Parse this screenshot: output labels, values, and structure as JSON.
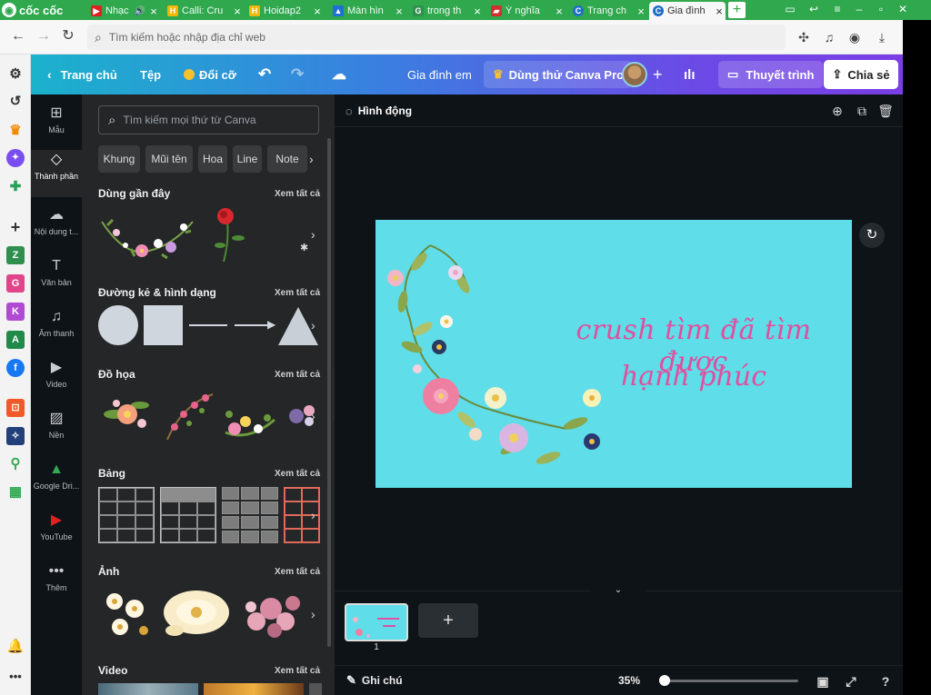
{
  "browser": {
    "brand": "cốc cốc",
    "tabs": [
      {
        "label": "Nhạc",
        "color": "#e02020",
        "glyph": "▶"
      },
      {
        "label": "Calli: Cru",
        "color": "#f2b705",
        "glyph": "H"
      },
      {
        "label": "Hoidap2",
        "color": "#f2b705",
        "glyph": "H"
      },
      {
        "label": "Màn hìn",
        "color": "#1e6fd9",
        "glyph": "▲"
      },
      {
        "label": "trong th",
        "color": "#2f8f4e",
        "glyph": "G"
      },
      {
        "label": "Ý nghĩa",
        "color": "#d32f2f",
        "glyph": "▰"
      },
      {
        "label": "Trang ch",
        "color": "#1f6fc7",
        "glyph": "C"
      },
      {
        "label": "Gia đình",
        "color": "#1f6fc7",
        "glyph": "C"
      }
    ],
    "new_tab": "+",
    "address_placeholder": "Tìm kiếm hoặc nhập địa chỉ web"
  },
  "canva": {
    "top": {
      "home": "Trang chủ",
      "file": "Tệp",
      "resize": "Đổi cỡ",
      "title": "Gia đình em",
      "pro": "Dùng thử Canva Pro",
      "present": "Thuyết trình",
      "share": "Chia sẻ"
    },
    "rail": [
      {
        "label": "Mẫu",
        "icon": "⊞"
      },
      {
        "label": "Thành phần",
        "icon": "◇"
      },
      {
        "label": "Nội dung t...",
        "icon": "☁"
      },
      {
        "label": "Văn bản",
        "icon": "T"
      },
      {
        "label": "Âm thanh",
        "icon": "♫"
      },
      {
        "label": "Video",
        "icon": "▶"
      },
      {
        "label": "Nền",
        "icon": "▨"
      },
      {
        "label": "Google Dri...",
        "icon": "▲"
      },
      {
        "label": "YouTube",
        "icon": "▶"
      },
      {
        "label": "Thêm",
        "icon": "•••"
      }
    ],
    "panel": {
      "search_placeholder": "Tìm kiếm mọi thứ từ Canva",
      "chips": [
        "Khung",
        "Mũi tên",
        "Hoa",
        "Line",
        "Note"
      ],
      "see_all": "Xem tất cả",
      "sections": {
        "recent": "Dùng gần đây",
        "lines": "Đường kẻ & hình dạng",
        "graphics": "Đồ họa",
        "tables": "Bảng",
        "photos": "Ảnh",
        "video": "Video"
      }
    },
    "editor": {
      "animate": "Hình động",
      "slide_line1": "crush tìm đã tìm được",
      "slide_line2": "hạnh phúc",
      "slide_bg": "#5fdde8",
      "text_color": "#e04fa0",
      "page_number": "1",
      "notes": "Ghi chú",
      "zoom": "35%"
    }
  }
}
